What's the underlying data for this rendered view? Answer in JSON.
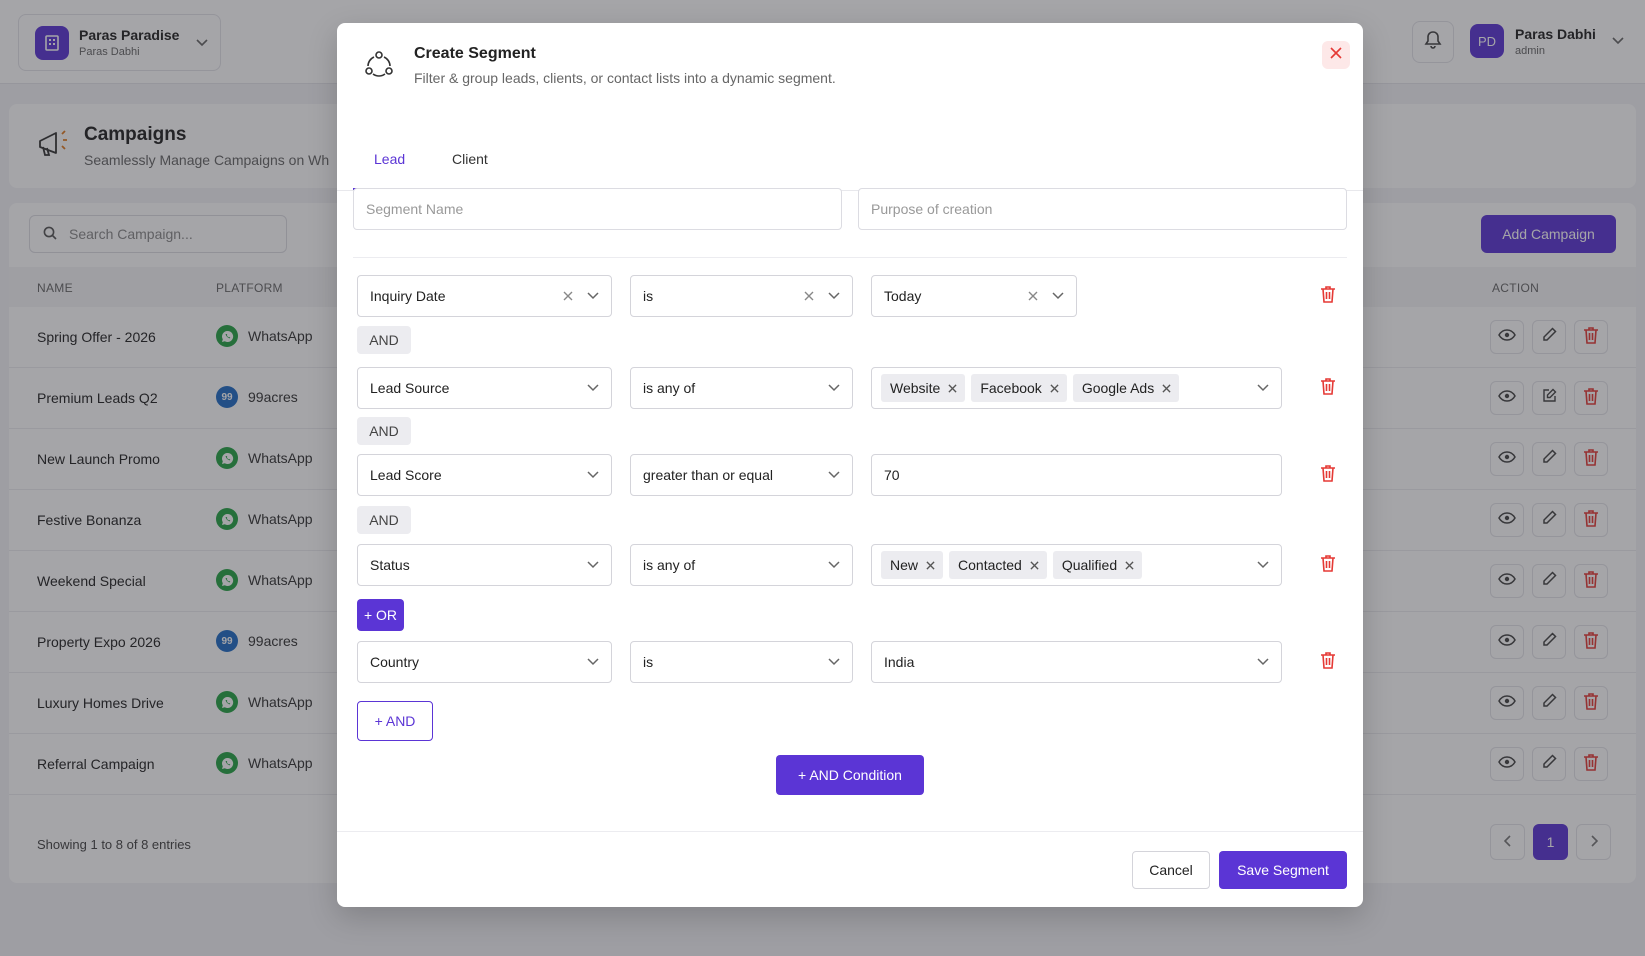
{
  "colors": {
    "brand": "#5b35d5",
    "danger": "#e53935",
    "whatsapp": "#25a244",
    "acres99": "#1f6cc4"
  },
  "workspace": {
    "name": "Paras Paradise",
    "owner": "Paras Dabhi"
  },
  "user": {
    "initials": "PD",
    "name": "Paras Dabhi",
    "role": "admin"
  },
  "page": {
    "title": "Campaigns",
    "subtitle": "Seamlessly Manage Campaigns on Wh"
  },
  "search": {
    "placeholder": "Search Campaign..."
  },
  "add_campaign_label": "Add Campaign",
  "table": {
    "columns": {
      "name": "NAME",
      "platform": "PLATFORM",
      "action": "ACTION"
    },
    "rows": [
      {
        "name": "Spring Offer - 2026",
        "platform": "WhatsApp",
        "icon": "whatsapp-icon"
      },
      {
        "name": "Premium Leads Q2",
        "platform": "99acres",
        "icon": "99acres-icon"
      },
      {
        "name": "New Launch Promo",
        "platform": "WhatsApp",
        "icon": "whatsapp-icon"
      },
      {
        "name": "Festive Bonanza",
        "platform": "WhatsApp",
        "icon": "whatsapp-icon"
      },
      {
        "name": "Weekend Special",
        "platform": "WhatsApp",
        "icon": "whatsapp-icon"
      },
      {
        "name": "Property Expo 2026",
        "platform": "99acres",
        "icon": "99acres-icon"
      },
      {
        "name": "Luxury Homes Drive",
        "platform": "WhatsApp",
        "icon": "whatsapp-icon"
      },
      {
        "name": "Referral Campaign",
        "platform": "WhatsApp",
        "icon": "whatsapp-icon"
      }
    ],
    "footer": "Showing 1 to 8 of 8 entries",
    "current_page": "1",
    "acres_badge": "99"
  },
  "modal": {
    "title": "Create Segment",
    "subtitle": "Filter & group leads, clients, or contact lists into a dynamic segment.",
    "tabs": {
      "lead": "Lead",
      "client": "Client"
    },
    "segment_name_placeholder": "Segment Name",
    "purpose_placeholder": "Purpose of creation",
    "conditions": [
      {
        "field": "Inquiry Date",
        "operator": "is",
        "value": "Today"
      },
      {
        "field": "Lead Source",
        "operator": "is any of",
        "chips": [
          "Website",
          "Facebook",
          "Google Ads"
        ]
      },
      {
        "field": "Lead Score",
        "operator": "greater than or equal",
        "value": "70"
      },
      {
        "field": "Status",
        "operator": "is any of",
        "chips": [
          "New",
          "Contacted",
          "Qualified"
        ]
      },
      {
        "field": "Country",
        "operator": "is",
        "value": "India"
      }
    ],
    "and_label": "AND",
    "or_button": "+ OR",
    "add_and_button": "+ AND",
    "add_and_condition_button": "+ AND Condition",
    "cancel": "Cancel",
    "save": "Save Segment"
  }
}
